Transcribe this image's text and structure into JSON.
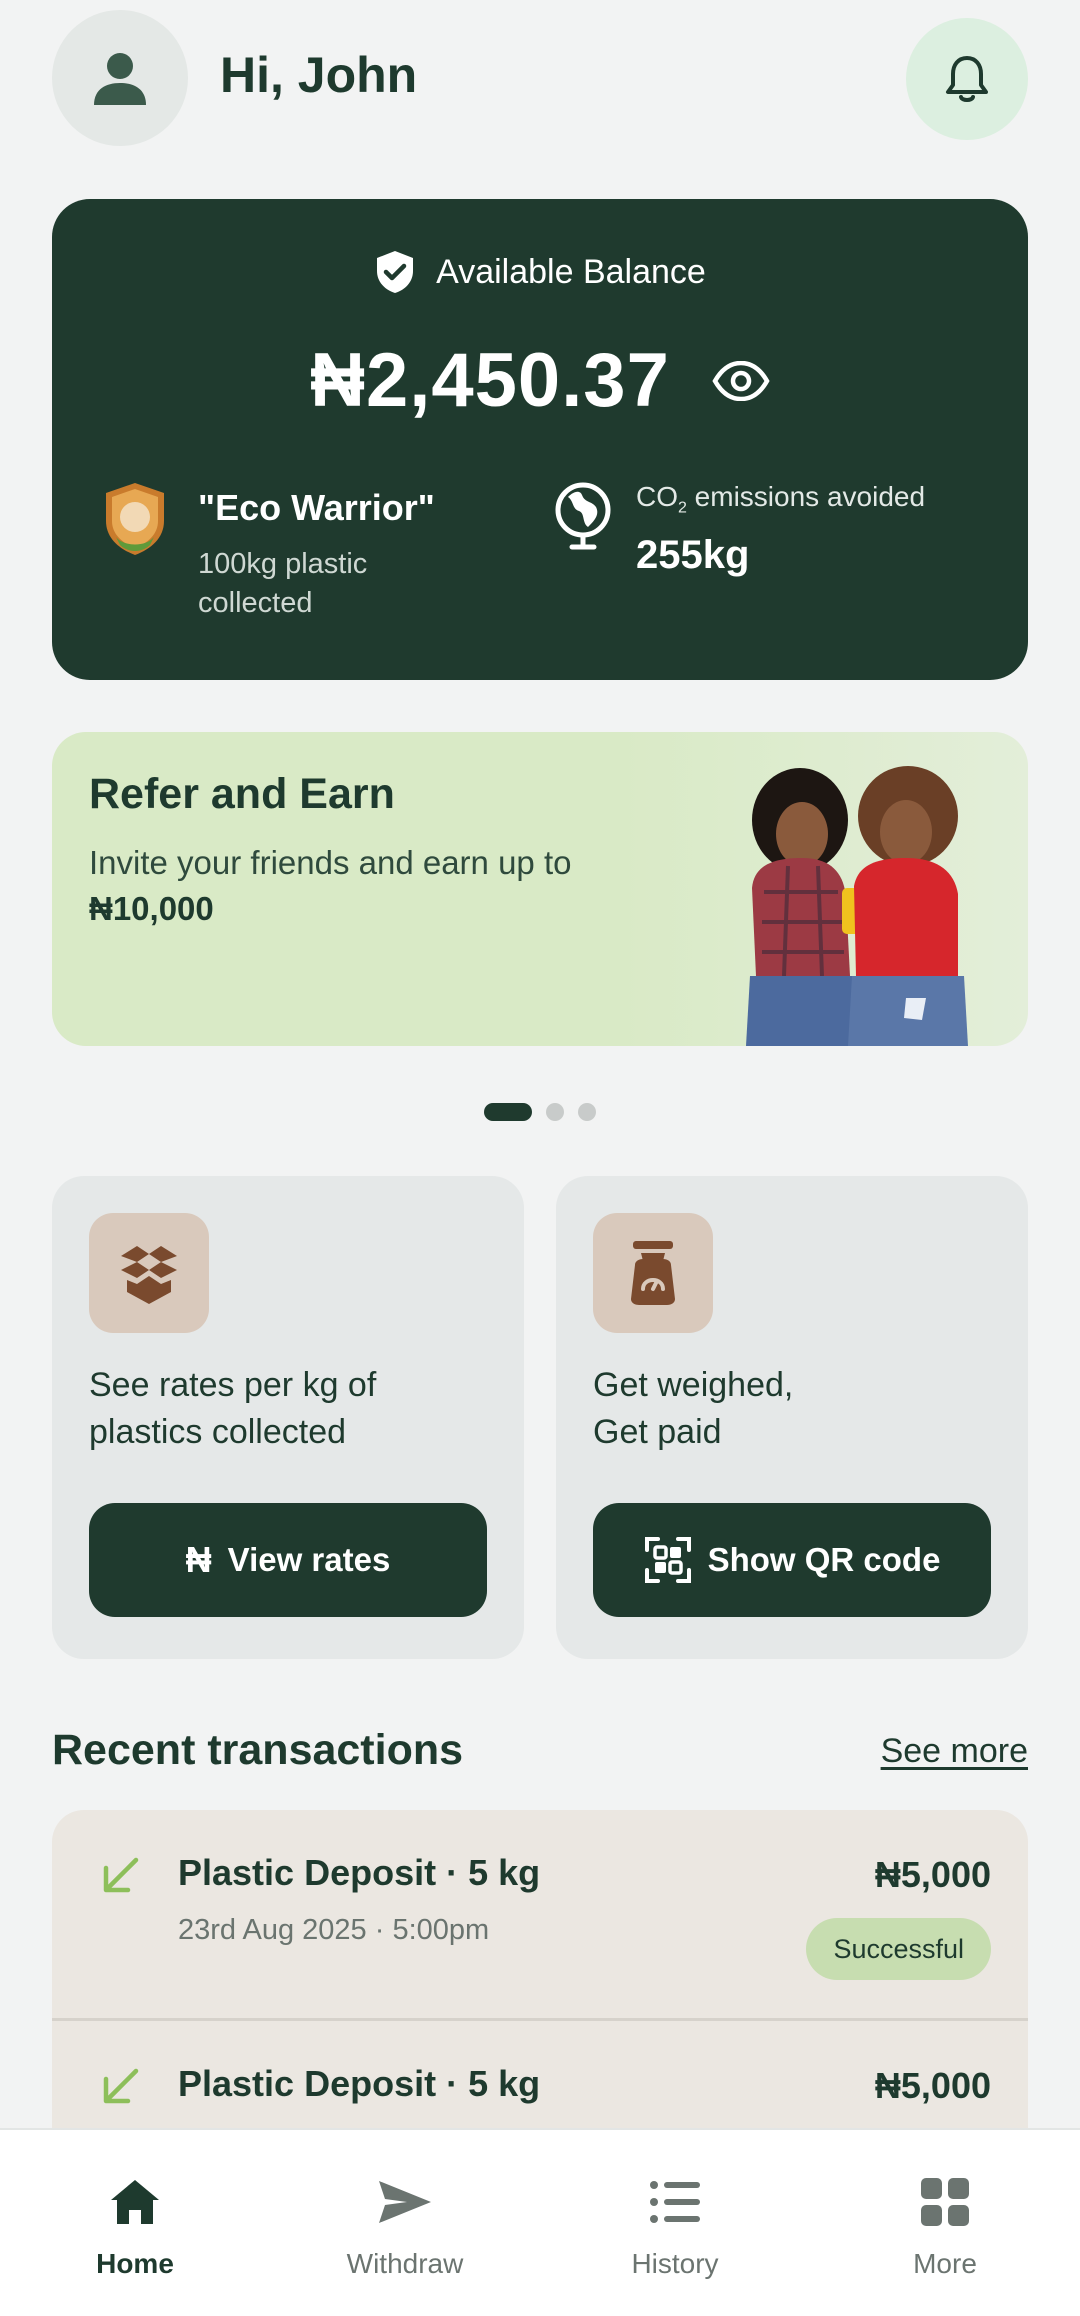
{
  "header": {
    "greeting": "Hi, John"
  },
  "balance": {
    "label": "Available Balance",
    "amount": "₦2,450.37",
    "badge_title": "\"Eco Warrior\"",
    "badge_subtitle": "100kg plastic collected",
    "co2_label_prefix": "CO",
    "co2_label_sub": "2",
    "co2_label_suffix": " emissions avoided",
    "co2_value": "255kg"
  },
  "refer": {
    "title": "Refer and Earn",
    "text": "Invite your friends and earn up to",
    "amount": "₦10,000"
  },
  "carousel": {
    "total": 3,
    "active_index": 0
  },
  "actions": [
    {
      "text_line1": "See rates per kg of",
      "text_line2": "plastics collected",
      "button_label": "View rates",
      "button_glyph": "₦",
      "icon": "box-icon"
    },
    {
      "text_line1": "Get weighed,",
      "text_line2": "Get paid",
      "button_label": "Show QR code",
      "icon": "scale-icon"
    }
  ],
  "transactions": {
    "title": "Recent transactions",
    "see_more": "See more",
    "items": [
      {
        "title": "Plastic Deposit · 5 kg",
        "date": "23rd Aug 2025 · 5:00pm",
        "amount": "₦5,000",
        "status": "Successful"
      },
      {
        "title": "Plastic Deposit · 5 kg",
        "amount": "₦5,000"
      }
    ]
  },
  "nav": [
    {
      "label": "Home",
      "icon": "home-icon",
      "active": true
    },
    {
      "label": "Withdraw",
      "icon": "send-icon",
      "active": false
    },
    {
      "label": "History",
      "icon": "list-icon",
      "active": false
    },
    {
      "label": "More",
      "icon": "grid-icon",
      "active": false
    }
  ],
  "colors": {
    "primary": "#1f3a2e",
    "accent_light": "#d9eac6",
    "status_bg": "#c7ddb0",
    "icon_tile": "#d9c9bc",
    "icon_brown": "#7a4a2e"
  }
}
